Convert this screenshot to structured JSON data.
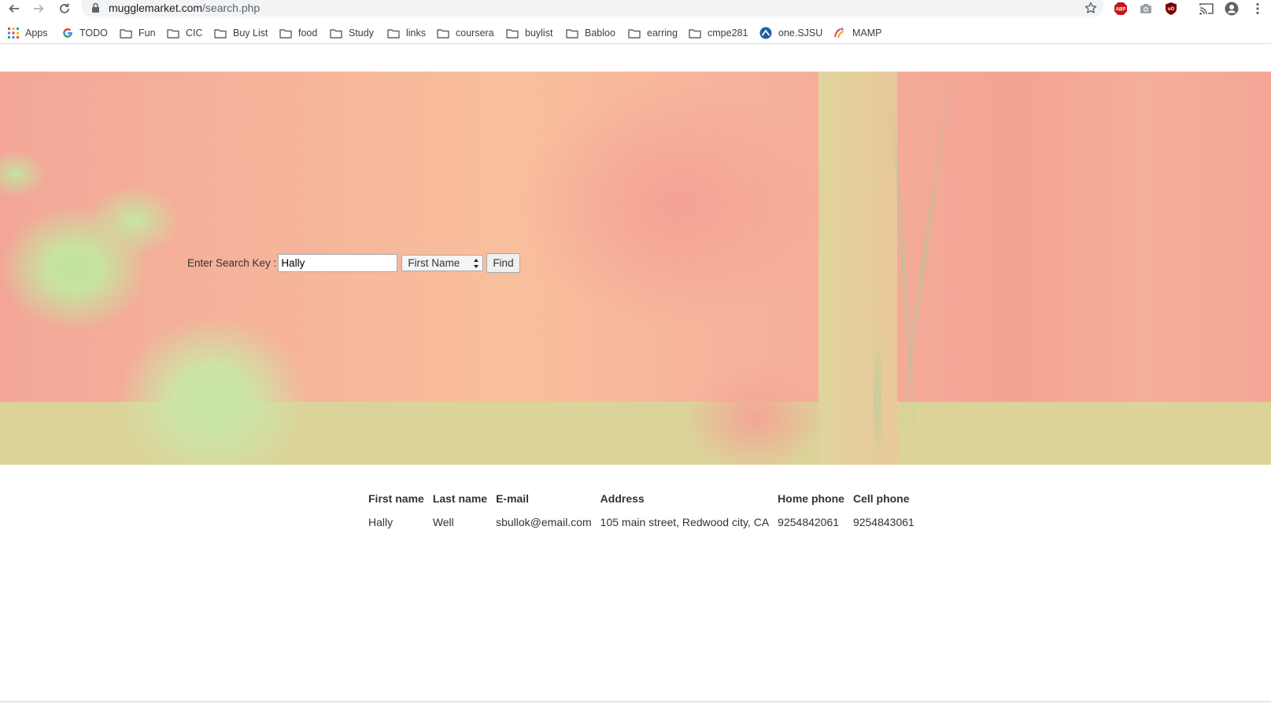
{
  "browser": {
    "url_host": "mugglemarket.com",
    "url_path": "/search.php",
    "extensions": [
      "abp-icon",
      "camera-icon",
      "ublock-icon"
    ],
    "bookmarks": [
      {
        "label": "Apps",
        "icon": "apps-grid-icon"
      },
      {
        "label": "TODO",
        "icon": "google-icon"
      },
      {
        "label": "Fun",
        "icon": "folder-icon"
      },
      {
        "label": "CIC",
        "icon": "folder-icon"
      },
      {
        "label": "Buy List",
        "icon": "folder-icon"
      },
      {
        "label": "food",
        "icon": "folder-icon"
      },
      {
        "label": "Study",
        "icon": "folder-icon"
      },
      {
        "label": "links",
        "icon": "folder-icon"
      },
      {
        "label": "coursera",
        "icon": "folder-icon"
      },
      {
        "label": "buylist",
        "icon": "folder-icon"
      },
      {
        "label": "Babloo",
        "icon": "folder-icon"
      },
      {
        "label": "earring",
        "icon": "folder-icon"
      },
      {
        "label": "cmpe281",
        "icon": "folder-icon"
      },
      {
        "label": "one.SJSU",
        "icon": "sjsu-icon"
      },
      {
        "label": "MAMP",
        "icon": "mamp-icon"
      }
    ]
  },
  "search": {
    "label": "Enter Search Key :",
    "value": "Hally",
    "field_selected": "First Name",
    "find_label": "Find"
  },
  "results": {
    "headers": [
      "First name",
      "Last name",
      "E-mail",
      "Address",
      "Home phone",
      "Cell phone"
    ],
    "rows": [
      [
        "Hally",
        "Well",
        "sbullok@email.com",
        "105 main street, Redwood city, CA",
        "9254842061",
        "9254843061"
      ]
    ]
  },
  "colors": {
    "hero_base": "#f5ae98",
    "hero_green": "#c6e7a5",
    "abp_red": "#c4161c",
    "ublock_red": "#800000"
  }
}
